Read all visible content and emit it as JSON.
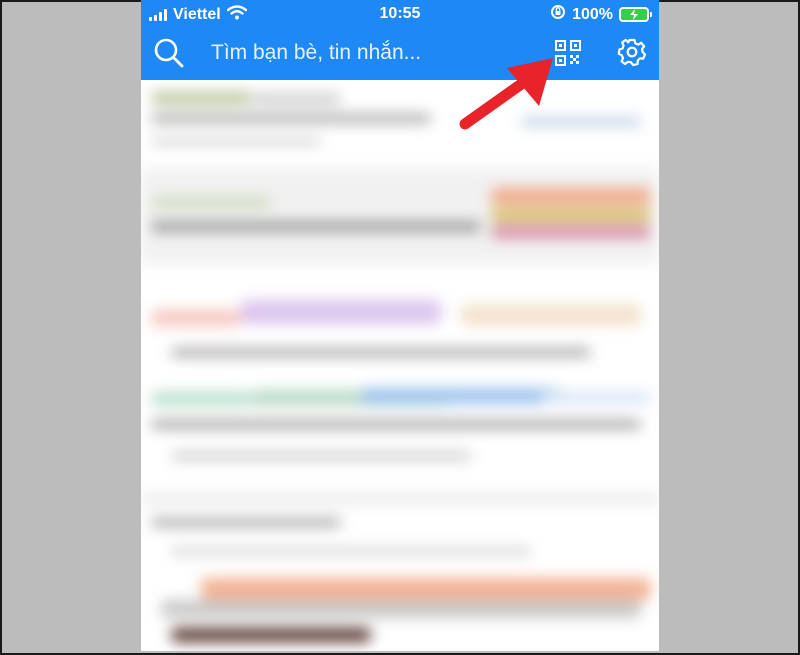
{
  "status_bar": {
    "carrier": "Viettel",
    "time": "10:55",
    "battery_percent": "100%"
  },
  "search_bar": {
    "placeholder": "Tìm bạn bè, tin nhắn..."
  },
  "icons": {
    "search": "search-icon",
    "qr": "qr-code-icon",
    "settings": "gear-icon",
    "wifi": "wifi-icon",
    "signal": "signal-icon",
    "orientation_lock": "rotation-lock-icon",
    "battery": "battery-charging-icon"
  },
  "colors": {
    "header": "#1e88f4",
    "arrow": "#e8232a",
    "background": "#bcbcbc"
  }
}
